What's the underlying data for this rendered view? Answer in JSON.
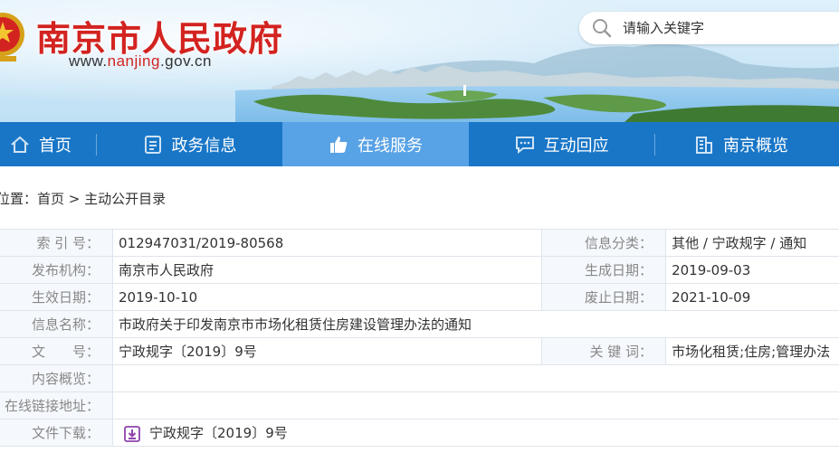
{
  "header": {
    "title": "南京市人民政府",
    "url_prefix": "www.",
    "url_highlight": "nanjing",
    "url_suffix": ".gov.cn",
    "emblem_icon": "national-emblem-icon"
  },
  "search": {
    "placeholder": "请输入关键字",
    "icon": "search-icon"
  },
  "nav": {
    "items": [
      {
        "label": "首页",
        "icon": "home-icon",
        "active": false
      },
      {
        "label": "政务信息",
        "icon": "document-icon",
        "active": false
      },
      {
        "label": "在线服务",
        "icon": "thumbs-up-icon",
        "active": true
      },
      {
        "label": "互动回应",
        "icon": "chat-icon",
        "active": false
      },
      {
        "label": "南京概览",
        "icon": "building-icon",
        "active": false
      }
    ]
  },
  "breadcrumb": {
    "prefix": "位置：",
    "home": "首页",
    "separator": " > ",
    "current": "主动公开目录"
  },
  "info": {
    "index_label": "索 引 号：",
    "index_value": "012947031/2019-80568",
    "category_label": "信息分类：",
    "category_value": "其他 / 宁政规字 / 通知",
    "publisher_label": "发布机构：",
    "publisher_value": "南京市人民政府",
    "created_label": "生成日期：",
    "created_value": "2019-09-03",
    "effective_label": "生效日期：",
    "effective_value": "2019-10-10",
    "expiry_label": "废止日期：",
    "expiry_value": "2021-10-09",
    "name_label": "信息名称：",
    "name_value": "市政府关于印发南京市市场化租赁住房建设管理办法的通知",
    "docno_label": "文　　号：",
    "docno_value": "宁政规字〔2019〕9号",
    "keywords_label": "关 键 词：",
    "keywords_value": "市场化租赁;住房;管理办法",
    "summary_label": "内容概览：",
    "summary_value": "",
    "link_label": "在线链接地址：",
    "link_value": "",
    "download_label": "文件下载：",
    "download_value": "宁政规字〔2019〕9号",
    "download_icon": "download-icon"
  },
  "colors": {
    "title_red": "#d32320",
    "nav_blue": "#1976c7",
    "nav_active": "#58a2e6",
    "label_bg": "#f5f8fc",
    "download_icon": "#8e44ad"
  }
}
